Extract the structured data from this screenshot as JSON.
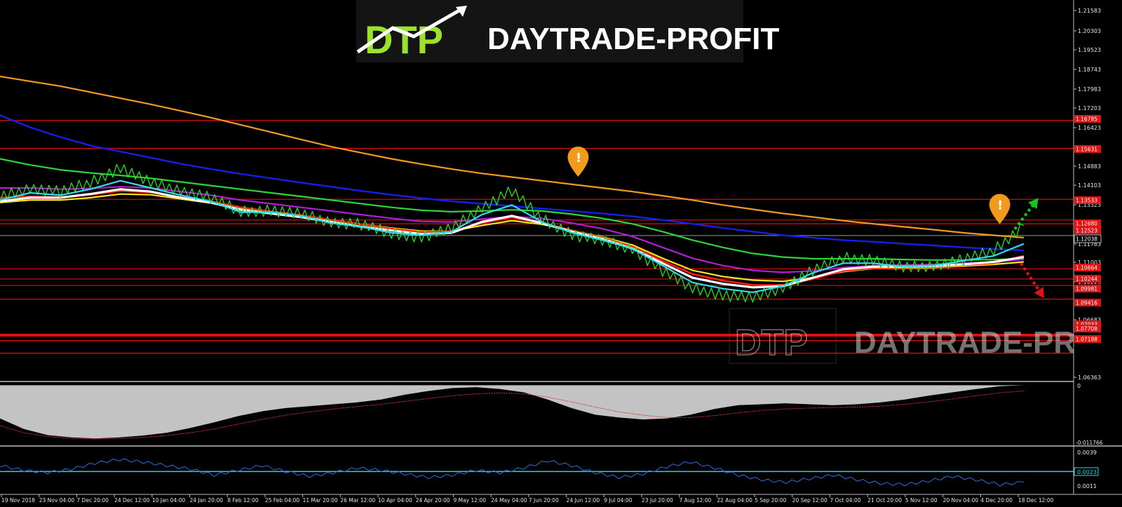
{
  "brand": {
    "logo_mark": "DTP",
    "logo_text": "DAYTRADE-PROFIT",
    "watermark_mark": "DTP",
    "watermark_text": "DAYTRADE-PROFIT"
  },
  "colors": {
    "background": "#000000",
    "price": "#22e01a",
    "ma_cyan": "#33dcee",
    "ma_white": "#ffffff",
    "ma_red": "#ff1a1a",
    "ma_yellow": "#f7e81a",
    "ma_purple": "#b21ed6",
    "ma_green": "#2fd43a",
    "ma_blue": "#1420e6",
    "ma_orange": "#f29a22",
    "level_line": "#e01010",
    "current_price_line": "#9a9a9a",
    "oscillator_fill": "#c3c3c3",
    "oscillator_signal": "#e03030",
    "lower_indicator": "#2a6fe0",
    "lower_level": "#24d7e8",
    "arrow_up": "#19c41c",
    "arrow_down": "#e01414",
    "alert_marker": "#f29a1c"
  },
  "chart_data": {
    "type": "line",
    "title": "",
    "xlabel": "",
    "ylabel": "",
    "ylim": [
      1.0605,
      1.2175
    ],
    "x_tick_labels": [
      "19 Nov 2018",
      "23 Nov 04:00",
      "7 Dec 20:00",
      "24 Dec 12:00",
      "10 Jan 04:00",
      "24 Jan 20:00",
      "8 Feb 12:00",
      "25 Feb 04:00",
      "11 Mar 20:00",
      "26 Mar 12:00",
      "10 Apr 04:00",
      "24 Apr 20:00",
      "9 May 12:00",
      "24 May 04:00",
      "7 Jun 20:00",
      "24 Jun 12:00",
      "9 Jul 04:00",
      "23 Jul 20:00",
      "7 Aug 12:00",
      "22 Aug 04:00",
      "5 Sep 20:00",
      "20 Sep 12:00",
      "7 Oct 04:00",
      "21 Oct 20:00",
      "5 Nov 12:00",
      "20 Nov 04:00",
      "4 Dec 20:00",
      "18 Dec 12:00"
    ],
    "y_tick_labels": [
      "1.21583",
      "1.20303",
      "1.19523",
      "1.18743",
      "1.17983",
      "1.17203",
      "1.16423",
      "1.14883",
      "1.14103",
      "1.13323",
      "1.11783",
      "1.11003",
      "1.10223",
      "1.06683",
      "1.06363"
    ],
    "price_tag_labels": [
      "1.16785",
      "1.15631",
      "1.13533",
      "1.12680",
      "1.12523",
      "1.12038",
      "1.10664",
      "1.10244",
      "1.09981",
      "1.09416",
      "1.07933",
      "1.07708",
      "1.07188"
    ],
    "current_price_label": "1.12038",
    "price_tags_highlighted": [
      true,
      true,
      true,
      true,
      true,
      false,
      true,
      true,
      true,
      true,
      true,
      true,
      true
    ],
    "horizontal_levels": [
      1.16785,
      1.15631,
      1.13533,
      1.1268,
      1.12523,
      1.10664,
      1.10244,
      1.09981,
      1.09416,
      1.07933,
      1.07708,
      1.07188
    ],
    "current_price": 1.12038,
    "series": [
      {
        "key": "price",
        "values": [
          1.136,
          1.14,
          1.1385,
          1.142,
          1.1485,
          1.142,
          1.139,
          1.136,
          1.13,
          1.131,
          1.129,
          1.126,
          1.125,
          1.121,
          1.12,
          1.123,
          1.132,
          1.139,
          1.127,
          1.121,
          1.118,
          1.115,
          1.106,
          1.0985,
          1.096,
          1.0945,
          1.099,
          1.106,
          1.111,
          1.1105,
          1.107,
          1.108,
          1.1105,
          1.114,
          1.1245
        ]
      },
      {
        "key": "ma_cyan",
        "values": [
          1.135,
          1.138,
          1.137,
          1.1395,
          1.143,
          1.14,
          1.137,
          1.1345,
          1.13,
          1.13,
          1.1285,
          1.1255,
          1.124,
          1.1215,
          1.1205,
          1.122,
          1.129,
          1.133,
          1.126,
          1.1215,
          1.1185,
          1.115,
          1.108,
          1.101,
          1.0985,
          1.097,
          1.0995,
          1.105,
          1.109,
          1.109,
          1.1075,
          1.108,
          1.11,
          1.112,
          1.117
        ]
      },
      {
        "key": "ma_white",
        "values": [
          1.1345,
          1.136,
          1.136,
          1.1375,
          1.1395,
          1.1385,
          1.136,
          1.134,
          1.131,
          1.1295,
          1.128,
          1.126,
          1.124,
          1.1225,
          1.121,
          1.1215,
          1.126,
          1.1285,
          1.1255,
          1.122,
          1.119,
          1.115,
          1.109,
          1.103,
          1.1005,
          1.099,
          1.0995,
          1.103,
          1.1065,
          1.1075,
          1.1075,
          1.1078,
          1.1085,
          1.1095,
          1.1115
        ]
      },
      {
        "key": "ma_red",
        "values": [
          1.136,
          1.1365,
          1.1362,
          1.1372,
          1.1388,
          1.1382,
          1.1362,
          1.1345,
          1.132,
          1.1303,
          1.1288,
          1.1268,
          1.125,
          1.1232,
          1.1218,
          1.1222,
          1.1255,
          1.1278,
          1.1255,
          1.1225,
          1.1195,
          1.1158,
          1.11,
          1.1045,
          1.1018,
          1.1,
          1.1,
          1.1025,
          1.1058,
          1.107,
          1.1072,
          1.1075,
          1.1082,
          1.109,
          1.112
        ]
      },
      {
        "key": "ma_yellow",
        "values": [
          1.134,
          1.135,
          1.135,
          1.136,
          1.1375,
          1.1372,
          1.1355,
          1.1338,
          1.1315,
          1.13,
          1.1285,
          1.1268,
          1.125,
          1.1235,
          1.1222,
          1.1222,
          1.1245,
          1.1265,
          1.125,
          1.1225,
          1.1198,
          1.1165,
          1.111,
          1.106,
          1.1035,
          1.102,
          1.1015,
          1.103,
          1.1055,
          1.1068,
          1.107,
          1.1072,
          1.1078,
          1.1085,
          1.1095
        ]
      },
      {
        "key": "ma_purple",
        "values": [
          1.14,
          1.14,
          1.1395,
          1.1398,
          1.1405,
          1.14,
          1.1385,
          1.137,
          1.135,
          1.1335,
          1.132,
          1.1305,
          1.129,
          1.1275,
          1.1262,
          1.126,
          1.1272,
          1.1282,
          1.1275,
          1.1255,
          1.1232,
          1.12,
          1.1155,
          1.111,
          1.108,
          1.106,
          1.1052,
          1.1058,
          1.1072,
          1.108,
          1.1082,
          1.1085,
          1.109,
          1.1095,
          1.1105
        ]
      },
      {
        "key": "ma_green",
        "values": [
          1.152,
          1.1495,
          1.1475,
          1.1462,
          1.1452,
          1.144,
          1.1425,
          1.141,
          1.1395,
          1.138,
          1.1365,
          1.135,
          1.1335,
          1.132,
          1.1308,
          1.1302,
          1.1305,
          1.131,
          1.1305,
          1.1292,
          1.1275,
          1.1252,
          1.122,
          1.1185,
          1.1155,
          1.113,
          1.1115,
          1.1108,
          1.1108,
          1.1108,
          1.1105,
          1.1103,
          1.1103,
          1.1105,
          1.1108
        ]
      },
      {
        "key": "ma_blue",
        "values": [
          1.17,
          1.165,
          1.161,
          1.1575,
          1.155,
          1.1525,
          1.15,
          1.1478,
          1.1458,
          1.144,
          1.1422,
          1.1405,
          1.1388,
          1.1372,
          1.1358,
          1.1345,
          1.1335,
          1.1325,
          1.1315,
          1.1305,
          1.1295,
          1.1283,
          1.1268,
          1.1252,
          1.1235,
          1.122,
          1.1205,
          1.1195,
          1.1185,
          1.1178,
          1.117,
          1.1163,
          1.1155,
          1.1148,
          1.1143
        ]
      },
      {
        "key": "ma_orange",
        "values": [
          1.186,
          1.184,
          1.182,
          1.1795,
          1.177,
          1.1745,
          1.1718,
          1.169,
          1.166,
          1.163,
          1.16,
          1.157,
          1.1545,
          1.152,
          1.1498,
          1.1478,
          1.146,
          1.1445,
          1.143,
          1.1415,
          1.14,
          1.1385,
          1.1368,
          1.135,
          1.133,
          1.1312,
          1.1295,
          1.128,
          1.1265,
          1.1252,
          1.124,
          1.1228,
          1.1215,
          1.1205,
          1.1195
        ]
      }
    ],
    "oscillator": {
      "y_tick_labels": [
        "0",
        "-0.011766"
      ],
      "ylim": [
        -0.0125,
        0.0005
      ],
      "histogram": [
        -0.007,
        -0.0092,
        -0.0105,
        -0.011,
        -0.0112,
        -0.011,
        -0.0106,
        -0.01,
        -0.009,
        -0.0078,
        -0.0065,
        -0.0055,
        -0.0048,
        -0.0044,
        -0.004,
        -0.0036,
        -0.003,
        -0.002,
        -0.0012,
        -0.0006,
        -0.0004,
        -0.0008,
        -0.0015,
        -0.003,
        -0.0048,
        -0.0062,
        -0.0068,
        -0.0072,
        -0.007,
        -0.0062,
        -0.005,
        -0.0042,
        -0.004,
        -0.0038,
        -0.004,
        -0.0042,
        -0.004,
        -0.0036,
        -0.003,
        -0.0022,
        -0.0015,
        -0.0008,
        -0.0002,
        0.0
      ],
      "signal": [
        -0.0085,
        -0.01,
        -0.0108,
        -0.0112,
        -0.0113,
        -0.0112,
        -0.011,
        -0.0106,
        -0.01,
        -0.0092,
        -0.0082,
        -0.0072,
        -0.0063,
        -0.0056,
        -0.005,
        -0.0045,
        -0.004,
        -0.0034,
        -0.0028,
        -0.0022,
        -0.0018,
        -0.0016,
        -0.0018,
        -0.0025,
        -0.0035,
        -0.0046,
        -0.0056,
        -0.0063,
        -0.0068,
        -0.0068,
        -0.0064,
        -0.0058,
        -0.0053,
        -0.005,
        -0.0048,
        -0.0047,
        -0.0046,
        -0.0044,
        -0.004,
        -0.0035,
        -0.0029,
        -0.0022,
        -0.0016,
        -0.0012
      ]
    },
    "lower_indicator": {
      "y_tick_labels": [
        "0.0039",
        "0.0023",
        "0.0011"
      ],
      "ylim": [
        0.0005,
        0.0042
      ],
      "level": 0.0023,
      "level_label": "0.0023",
      "values": [
        0.0028,
        0.0024,
        0.0022,
        0.0025,
        0.003,
        0.0033,
        0.0031,
        0.0028,
        0.0025,
        0.002,
        0.0024,
        0.0028,
        0.0023,
        0.0019,
        0.0022,
        0.0026,
        0.0024,
        0.0021,
        0.0018,
        0.002,
        0.0024,
        0.0022,
        0.0026,
        0.0032,
        0.0028,
        0.0022,
        0.0018,
        0.0021,
        0.0027,
        0.0031,
        0.0026,
        0.002,
        0.0016,
        0.0014,
        0.0017,
        0.002,
        0.0016,
        0.0013,
        0.0012,
        0.0015,
        0.0019,
        0.0016,
        0.0012,
        0.0014
      ]
    },
    "annotations": [
      {
        "type": "alert",
        "x_index": 19.2,
        "value": 1.14
      },
      {
        "type": "alert",
        "x_index": 33.2,
        "value": 1.1205
      },
      {
        "type": "arrow",
        "direction": "up",
        "from_index": 33.7,
        "from": 1.123,
        "to": 1.1345
      },
      {
        "type": "arrow",
        "direction": "down",
        "from_index": 33.9,
        "from": 1.109,
        "to": 1.096
      }
    ]
  }
}
